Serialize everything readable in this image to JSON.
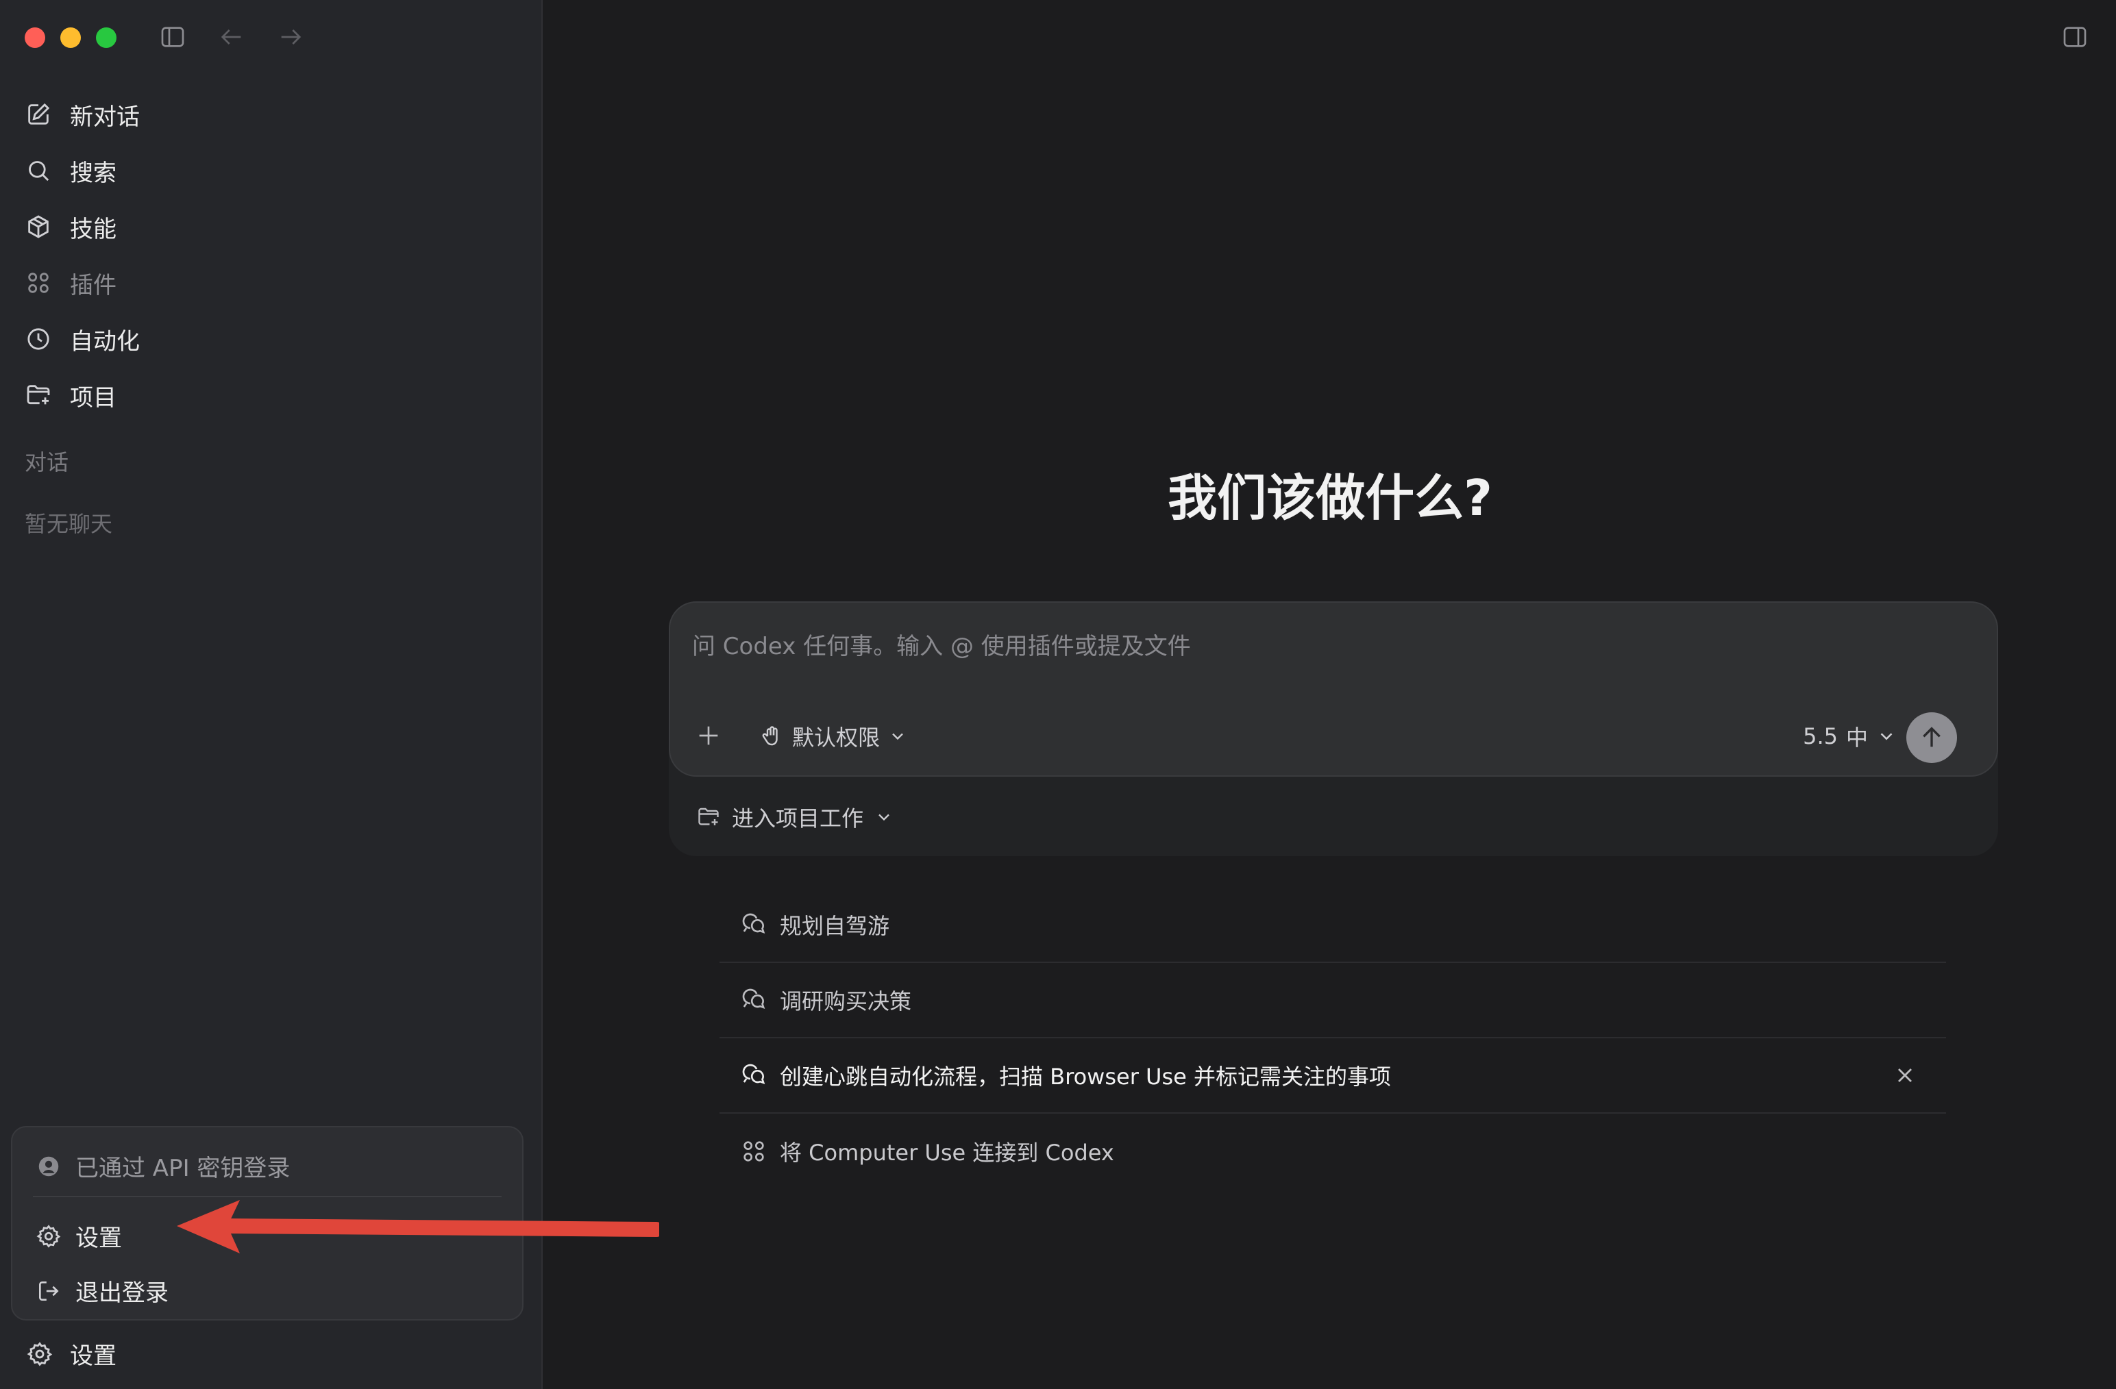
{
  "sidebar": {
    "nav": [
      {
        "label": "新对话",
        "icon": "edit-icon"
      },
      {
        "label": "搜索",
        "icon": "search-icon"
      },
      {
        "label": "技能",
        "icon": "cube-icon"
      },
      {
        "label": "插件",
        "icon": "grid-icon"
      },
      {
        "label": "自动化",
        "icon": "clock-icon"
      },
      {
        "label": "项目",
        "icon": "folder-add-icon"
      }
    ],
    "section_label": "对话",
    "empty_label": "暂无聊天",
    "popup": {
      "login_status": "已通过 API 密钥登录",
      "settings": "设置",
      "logout": "退出登录"
    },
    "bottom_settings": "设置"
  },
  "main": {
    "headline": "我们该做什么?",
    "composer": {
      "placeholder": "问 Codex 任何事。输入 @ 使用插件或提及文件",
      "permission": "默认权限",
      "model": "5.5",
      "effort": "中",
      "project": "进入项目工作"
    },
    "suggestions": [
      {
        "label": "规划自驾游"
      },
      {
        "label": "调研购买决策"
      },
      {
        "label": "创建心跳自动化流程，扫描 Browser Use 并标记需关注的事项"
      },
      {
        "label": "将 Computer Use 连接到 Codex"
      }
    ]
  },
  "colors": {
    "accent_arrow": "#e0463a",
    "sidebar_bg": "#25262a",
    "main_bg": "#1c1c1e"
  }
}
